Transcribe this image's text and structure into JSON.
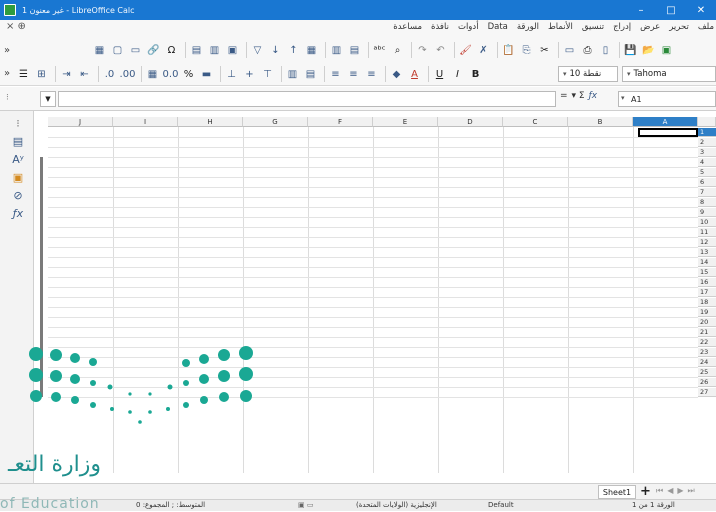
{
  "window": {
    "title": "غير معنون 1 - LibreOffice Calc",
    "buttons": [
      "–",
      "□",
      "✕"
    ]
  },
  "menubar": {
    "items": [
      "ملف",
      "تحرير",
      "عرض",
      "إدراج",
      "تنسيق",
      "الأنماط",
      "الورقة",
      "Data",
      "أدوات",
      "نافذة",
      "مساعدة"
    ]
  },
  "formatting": {
    "font_name": "Tahoma",
    "font_size": "نقطة 10"
  },
  "formula_bar": {
    "name_box": "A1",
    "content": ""
  },
  "grid": {
    "columns": [
      "J",
      "I",
      "H",
      "G",
      "F",
      "E",
      "D",
      "C",
      "B",
      "A"
    ],
    "rows": [
      "1",
      "2",
      "3",
      "4",
      "5",
      "6",
      "7",
      "8",
      "9",
      "10",
      "11",
      "12",
      "13",
      "14",
      "15",
      "16",
      "17",
      "18",
      "19",
      "20",
      "21",
      "22",
      "23",
      "24",
      "25",
      "26",
      "27"
    ],
    "active_cell": "A1",
    "active_column": "A",
    "active_row": "1"
  },
  "sheets": {
    "tabs": [
      "Sheet1"
    ]
  },
  "status_bar": {
    "page": "الورقة 1 من 1",
    "style": "Default",
    "language": "الإنجليزية (الولايات المتحدة)",
    "stats": "المتوسط: ; المجموع: 0"
  },
  "watermark": {
    "arabic": "وزارة التعـ",
    "english": "of Education"
  }
}
